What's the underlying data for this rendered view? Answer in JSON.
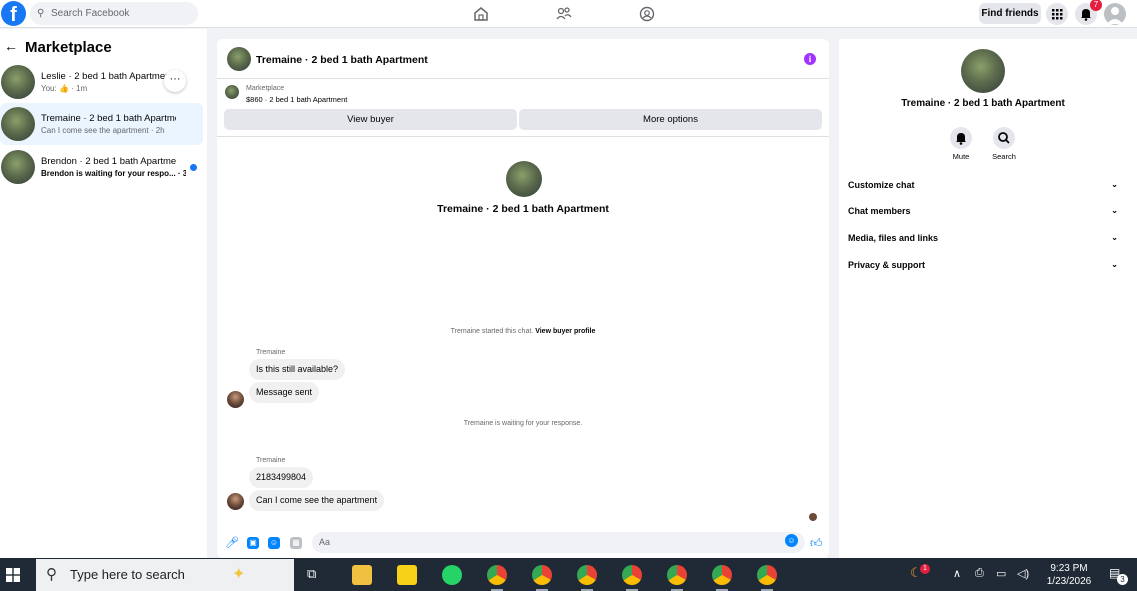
{
  "topbar": {
    "logo_letter": "f",
    "search_placeholder": "Search Facebook",
    "find_friends": "Find friends",
    "notification_count": "7"
  },
  "left": {
    "title": "Marketplace",
    "conversations": [
      {
        "name": "Leslie · 2 bed 1 bath Apartment",
        "sub": "You: 👍 · 1m"
      },
      {
        "name": "Tremaine · 2 bed 1 bath Apartment",
        "sub": "Can I come see the apartment · 2h"
      },
      {
        "name": "Brendon · 2 bed 1 bath Apartment",
        "sub": "Brendon is waiting for your respo... · 3h"
      }
    ]
  },
  "chat": {
    "header_title": "Tremaine · 2 bed 1 bath Apartment",
    "listing_source": "Marketplace",
    "listing_price": "$860 · 2 bed 1 bath Apartment",
    "view_buyer": "View buyer",
    "more_options": "More options",
    "center_title": "Tremaine · 2 bed 1 bath Apartment",
    "started_text": "Tremaine started this chat.",
    "view_profile": "View buyer profile",
    "sender1": "Tremaine",
    "msg1": "Is this still available?",
    "msg2": "Message sent",
    "waiting": "Tremaine is waiting for your response.",
    "sender2": "Tremaine",
    "msg3": "2183499804",
    "msg4": "Can I come see the apartment",
    "composer_placeholder": "Aa"
  },
  "right": {
    "title": "Tremaine · 2 bed 1 bath Apartment",
    "mute": "Mute",
    "search": "Search",
    "rows": [
      "Customize chat",
      "Chat members",
      "Media, files and links",
      "Privacy & support"
    ]
  },
  "taskbar": {
    "search_text": "Type here to search",
    "time": "9:23 PM",
    "date": "1/23/2026",
    "weather_badge": "1",
    "notif_count": "3"
  },
  "colors": {
    "fb_blue": "#1877f2",
    "messenger_blue": "#0084ff",
    "info_purple": "#a033ff",
    "badge_red": "#e41e3f"
  }
}
